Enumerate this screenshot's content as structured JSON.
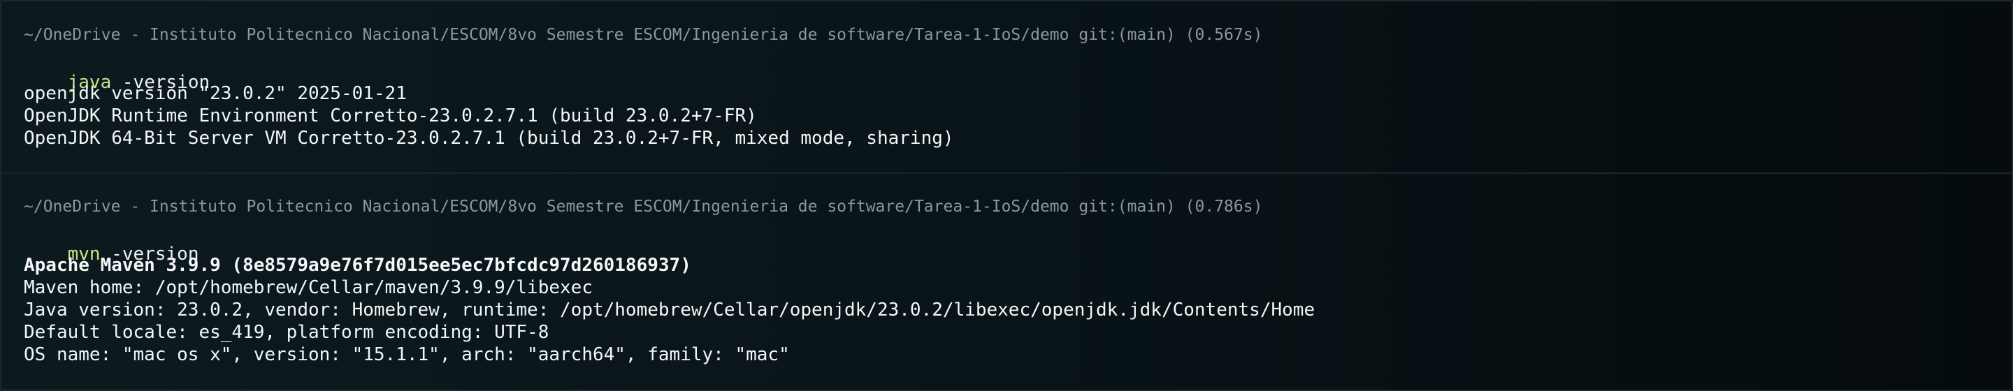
{
  "blocks": [
    {
      "prompt": "~/OneDrive - Instituto Politecnico Nacional/ESCOM/8vo Semestre ESCOM/Ingenieria de software/Tarea-1-IoS/demo git:(main) (0.567s)",
      "command": {
        "exe": "java",
        "args": " -version"
      },
      "output": [
        "openjdk version \"23.0.2\" 2025-01-21",
        "OpenJDK Runtime Environment Corretto-23.0.2.7.1 (build 23.0.2+7-FR)",
        "OpenJDK 64-Bit Server VM Corretto-23.0.2.7.1 (build 23.0.2+7-FR, mixed mode, sharing)"
      ]
    },
    {
      "prompt": "~/OneDrive - Instituto Politecnico Nacional/ESCOM/8vo Semestre ESCOM/Ingenieria de software/Tarea-1-IoS/demo git:(main) (0.786s)",
      "command": {
        "exe": "mvn",
        "args": " -version"
      },
      "output": [
        "Apache Maven 3.9.9 (8e8579a9e76f7d015ee5ec7bfcdc97d260186937)",
        "Maven home: /opt/homebrew/Cellar/maven/3.9.9/libexec",
        "Java version: 23.0.2, vendor: Homebrew, runtime: /opt/homebrew/Cellar/openjdk/23.0.2/libexec/openjdk.jdk/Contents/Home",
        "Default locale: es_419, platform encoding: UTF-8",
        "OS name: \"mac os x\", version: \"15.1.1\", arch: \"aarch64\", family: \"mac\""
      ]
    }
  ],
  "colors": {
    "prompt": "#8d969b",
    "command_exe": "#c7e48a",
    "output": "#f4f6f7",
    "background": "#091418"
  }
}
